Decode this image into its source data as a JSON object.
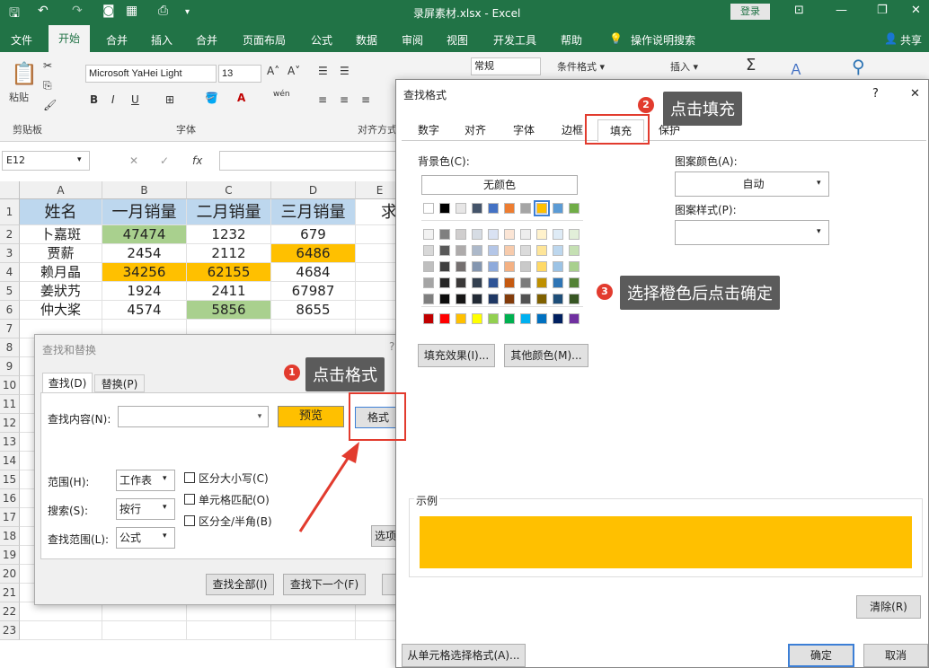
{
  "titlebar": {
    "title": "录屏素材.xlsx  -  Excel",
    "login": "登录",
    "min": "—",
    "restore": "❐",
    "close": "✕",
    "ribbon_opt": "⊡"
  },
  "menu": {
    "items": [
      "文件",
      "开始",
      "合并",
      "插入",
      "合并",
      "页面布局",
      "公式",
      "数据",
      "审阅",
      "视图",
      "开发工具",
      "帮助",
      "操作说明搜索"
    ],
    "share": "共享"
  },
  "ribbon": {
    "paste": "粘贴",
    "clipboard": "剪贴板",
    "font_group": "字体",
    "align_group": "对齐方式",
    "font_name": "Microsoft YaHei Light",
    "font_size": "13",
    "bold": "B",
    "italic": "I",
    "underline": "U",
    "number_format": "常规",
    "cond_format": "条件格式 ▾",
    "insert": "插入 ▾",
    "wen": "wén"
  },
  "formula": {
    "namebox": "E12",
    "fx": "fx"
  },
  "grid": {
    "columns": [
      "A",
      "B",
      "C",
      "D",
      "E"
    ],
    "rows": [
      "1",
      "2",
      "3",
      "4",
      "5",
      "6",
      "7",
      "8",
      "9",
      "10",
      "11",
      "12",
      "13",
      "14",
      "15",
      "16",
      "17",
      "18",
      "19",
      "20",
      "21",
      "22",
      "23"
    ],
    "header": [
      "姓名",
      "一月销量",
      "二月销量",
      "三月销量",
      "求"
    ],
    "data": [
      [
        "卜嘉斑",
        "47474",
        "1232",
        "679"
      ],
      [
        "贾薪",
        "2454",
        "2112",
        "6486"
      ],
      [
        "赖月晶",
        "34256",
        "62155",
        "4684"
      ],
      [
        "姜狀艿",
        "1924",
        "2411",
        "67987"
      ],
      [
        "仲大桨",
        "4574",
        "5856",
        "8655"
      ]
    ],
    "colors": {
      "header": "#bdd7ee",
      "green": "#a9d08e",
      "orange": "#ffc000"
    }
  },
  "find_replace": {
    "title": "查找和替换",
    "tab_find": "查找(D)",
    "tab_replace": "替换(P)",
    "find_label": "查找内容(N):",
    "preview": "预览",
    "format": "格式",
    "scope_label": "范围(H):",
    "scope_value": "工作表",
    "search_label": "搜索(S):",
    "search_value": "按行",
    "lookin_label": "查找范围(L):",
    "lookin_value": "公式",
    "match_case": "区分大小写(C)",
    "match_cell": "单元格匹配(O)",
    "match_width": "区分全/半角(B)",
    "options": "选项",
    "find_all": "查找全部(I)",
    "find_next": "查找下一个(F)"
  },
  "find_format": {
    "title": "查找格式",
    "help": "?",
    "close": "✕",
    "tabs": [
      "数字",
      "对齐",
      "字体",
      "边框",
      "填充",
      "保护"
    ],
    "bg_label": "背景色(C):",
    "no_color": "无颜色",
    "pattern_color_label": "图案颜色(A):",
    "pattern_color_value": "自动",
    "pattern_style_label": "图案样式(P):",
    "fill_effects": "填充效果(I)...",
    "more_colors": "其他颜色(M)...",
    "sample_label": "示例",
    "sample_color": "#ffc000",
    "clear": "清除(R)",
    "from_cell": "从单元格选择格式(A)...",
    "ok": "确定",
    "cancel": "取消",
    "theme_top": [
      "#ffffff",
      "#000000",
      "#e7e6e6",
      "#44546a",
      "#4472c4",
      "#ed7d31",
      "#a5a5a5",
      "#ffc000",
      "#5b9bd5",
      "#70ad47"
    ],
    "theme_rows": [
      [
        "#f2f2f2",
        "#7f7f7f",
        "#d0cece",
        "#d6dce4",
        "#d9e2f3",
        "#fbe5d5",
        "#ededed",
        "#fff2cc",
        "#deebf6",
        "#e2efd9"
      ],
      [
        "#d8d8d8",
        "#595959",
        "#aeabab",
        "#adb9ca",
        "#b4c6e7",
        "#f7cbac",
        "#dbdbdb",
        "#fee599",
        "#bdd7ee",
        "#c5e0b3"
      ],
      [
        "#bfbfbf",
        "#3f3f3f",
        "#757070",
        "#8496b0",
        "#8eaadb",
        "#f4b183",
        "#c9c9c9",
        "#ffd965",
        "#9cc3e5",
        "#a8d08d"
      ],
      [
        "#a5a5a5",
        "#262626",
        "#3a3838",
        "#323f4f",
        "#2f5496",
        "#c55a11",
        "#7b7b7b",
        "#bf9000",
        "#2e75b5",
        "#538135"
      ],
      [
        "#7f7f7f",
        "#0c0c0c",
        "#171616",
        "#222a35",
        "#1f3864",
        "#833c0b",
        "#525252",
        "#7f6000",
        "#1e4e79",
        "#375623"
      ]
    ],
    "standard": [
      "#c00000",
      "#ff0000",
      "#ffc000",
      "#ffff00",
      "#92d050",
      "#00b050",
      "#00b0f0",
      "#0070c0",
      "#002060",
      "#7030a0"
    ]
  },
  "annotations": {
    "step1": "点击格式",
    "step2": "点击填充",
    "step3": "选择橙色后点击确定",
    "n1": "1",
    "n2": "2",
    "n3": "3"
  }
}
